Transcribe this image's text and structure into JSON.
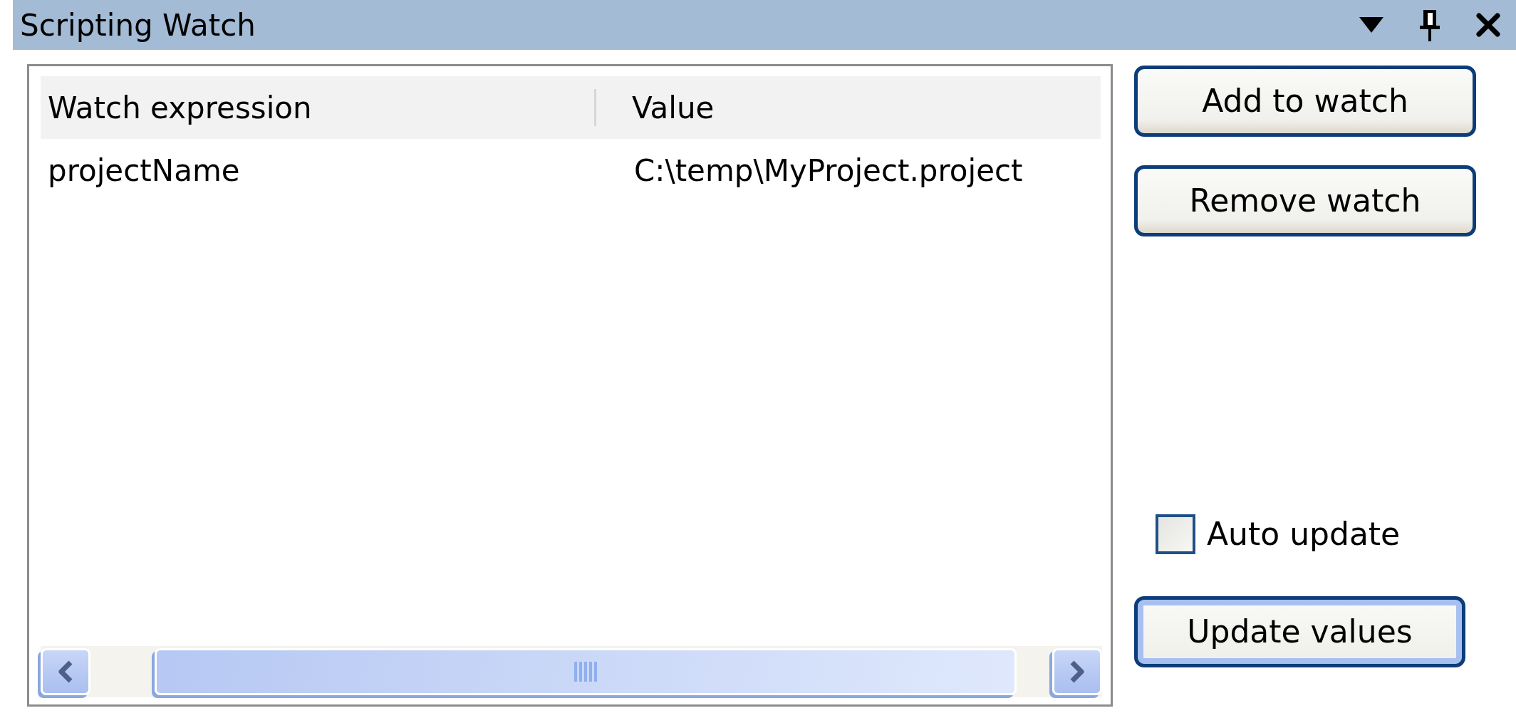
{
  "window": {
    "title": "Scripting Watch"
  },
  "table": {
    "columns": [
      "Watch expression",
      "Value"
    ],
    "rows": [
      [
        "projectName",
        "C:\\temp\\MyProject.project"
      ]
    ]
  },
  "buttons": [
    {
      "label": "Add to watch",
      "default": false
    },
    {
      "label": "Remove watch",
      "default": false
    }
  ],
  "auto_update": {
    "label": "Auto update",
    "checked": false
  },
  "update_button": {
    "label": "Update values",
    "default": true
  }
}
